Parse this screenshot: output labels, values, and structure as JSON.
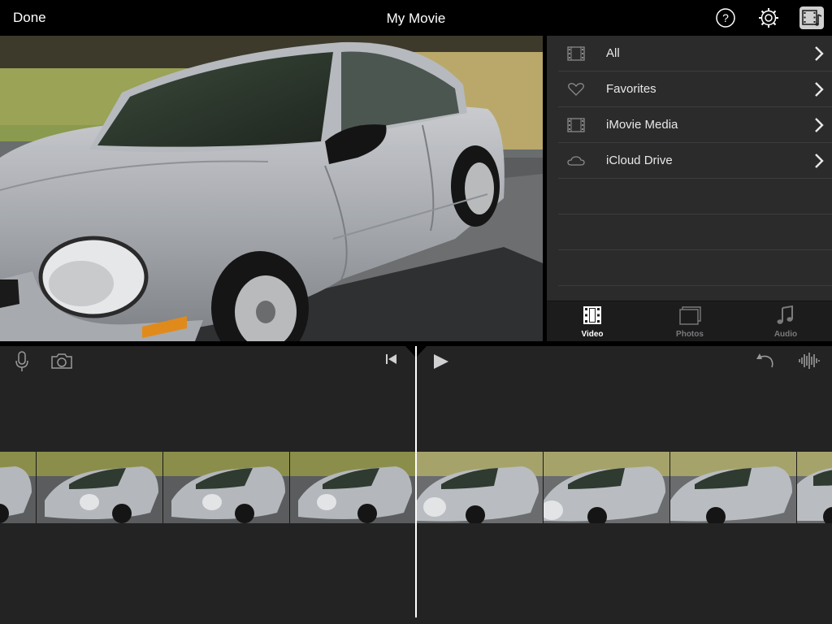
{
  "topbar": {
    "done_label": "Done",
    "title": "My Movie",
    "icons": [
      "help-icon",
      "gear-icon",
      "media-browser-icon"
    ]
  },
  "browser": {
    "rows": [
      {
        "label": "All",
        "icon": "film-icon"
      },
      {
        "label": "Favorites",
        "icon": "heart-icon"
      },
      {
        "label": "iMovie Media",
        "icon": "film-icon"
      },
      {
        "label": "iCloud Drive",
        "icon": "cloud-icon"
      }
    ],
    "tabs": [
      {
        "label": "Video",
        "icon": "video-icon",
        "selected": true
      },
      {
        "label": "Photos",
        "icon": "photos-icon",
        "selected": false
      },
      {
        "label": "Audio",
        "icon": "music-note-icon",
        "selected": false
      }
    ]
  },
  "timeline": {
    "icons": [
      "microphone-icon",
      "camera-icon",
      "skip-to-start-icon",
      "play-icon",
      "undo-icon",
      "waveform-icon"
    ],
    "clip_frame_count": 7
  },
  "colors": {
    "background": "#000000",
    "panel": "#2b2b2c",
    "timeline": "#232324",
    "accent": "#ffffff",
    "inactive_tab": "#7a7a7c"
  }
}
